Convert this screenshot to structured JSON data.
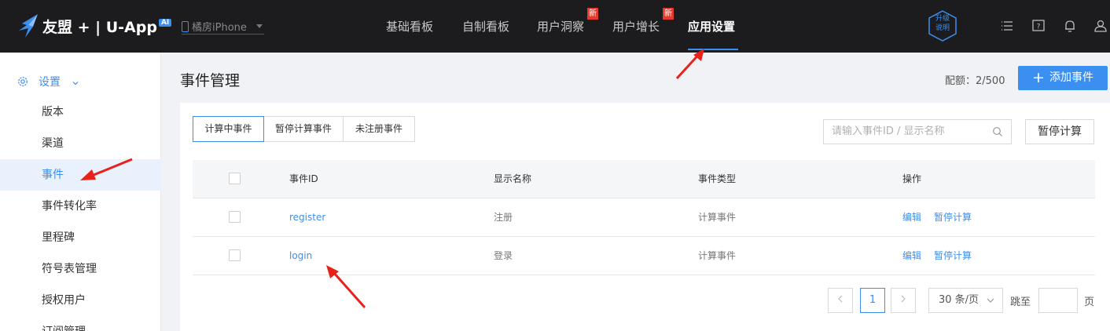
{
  "brand": {
    "name": "友盟 + | U-App",
    "ai_badge": "AI"
  },
  "app_selector": {
    "value": "橘房iPhone"
  },
  "nav": {
    "items": [
      {
        "label": "基础看板"
      },
      {
        "label": "自制看板"
      },
      {
        "label": "用户洞察",
        "badge": "新"
      },
      {
        "label": "用户增长",
        "badge": "新"
      },
      {
        "label": "应用设置",
        "active": true
      }
    ]
  },
  "upgrade": {
    "line1": "升级",
    "line2": "说明"
  },
  "sidebar": {
    "head": "设置",
    "items": [
      {
        "label": "版本"
      },
      {
        "label": "渠道"
      },
      {
        "label": "事件",
        "active": true
      },
      {
        "label": "事件转化率"
      },
      {
        "label": "里程碑"
      },
      {
        "label": "符号表管理"
      },
      {
        "label": "授权用户"
      },
      {
        "label": "订阅管理"
      }
    ]
  },
  "page": {
    "title": "事件管理",
    "quota": "配额：2/500",
    "add_button": "添加事件"
  },
  "tabs": [
    {
      "label": "计算中事件",
      "active": true
    },
    {
      "label": "暂停计算事件"
    },
    {
      "label": "未注册事件"
    }
  ],
  "search": {
    "placeholder": "请输入事件ID / 显示名称"
  },
  "pause_button": "暂停计算",
  "table": {
    "headers": [
      "事件ID",
      "显示名称",
      "事件类型",
      "操作"
    ],
    "rows": [
      {
        "id": "register",
        "name": "注册",
        "type": "计算事件",
        "edit": "编辑",
        "pause": "暂停计算"
      },
      {
        "id": "login",
        "name": "登录",
        "type": "计算事件",
        "edit": "编辑",
        "pause": "暂停计算"
      }
    ]
  },
  "pagination": {
    "current": "1",
    "page_size": "30 条/页",
    "goto_label": "跳至",
    "page_suffix": "页"
  },
  "colors": {
    "accent": "#3b8ff0",
    "topbar": "#1c1c1e",
    "badge": "#e63a2e",
    "annotation": "#e8221b"
  }
}
